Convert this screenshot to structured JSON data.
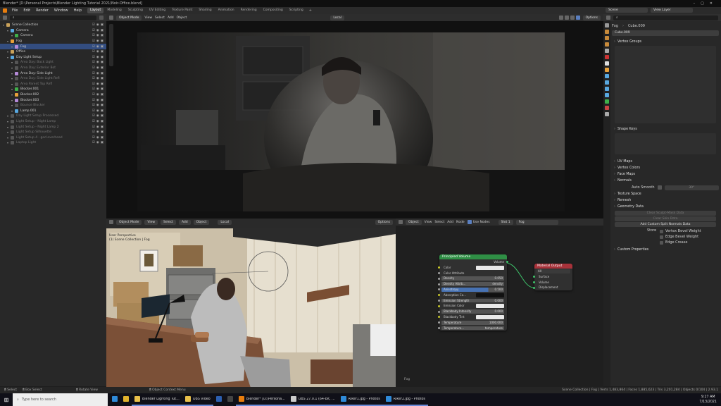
{
  "window": {
    "title": "Blender* [D:\\Personal Projects\\Blender Lighting Tutorial 2021\\Noir-Office.blend]"
  },
  "menus": [
    "File",
    "Edit",
    "Render",
    "Window",
    "Help"
  ],
  "workspace_tabs": [
    "Layout",
    "Modeling",
    "Sculpting",
    "UV Editing",
    "Texture Paint",
    "Shading",
    "Animation",
    "Rendering",
    "Compositing",
    "Scripting"
  ],
  "header_right": {
    "scene": "Scene",
    "view_layer": "View Layer"
  },
  "outliner": {
    "search_placeholder": "",
    "rows": [
      {
        "name": "Scene Collection",
        "indent": 0,
        "dim": false,
        "selected": false
      },
      {
        "name": "Camera",
        "indent": 1,
        "dim": false,
        "selected": false
      },
      {
        "name": "Camera",
        "indent": 2,
        "dim": false,
        "selected": false
      },
      {
        "name": "Fog",
        "indent": 1,
        "dim": false,
        "selected": false
      },
      {
        "name": "Fog",
        "indent": 2,
        "dim": false,
        "selected": true
      },
      {
        "name": "Office",
        "indent": 1,
        "dim": false,
        "selected": false
      },
      {
        "name": "Day Light Setup",
        "indent": 1,
        "dim": false,
        "selected": false
      },
      {
        "name": "Area Day: Back Light",
        "indent": 2,
        "dim": true,
        "selected": false
      },
      {
        "name": "Area Day: Exterior Bot",
        "indent": 2,
        "dim": true,
        "selected": false
      },
      {
        "name": "Area Day: Side Light",
        "indent": 2,
        "dim": false,
        "selected": false
      },
      {
        "name": "Area Day: Side Light Refl",
        "indent": 2,
        "dim": true,
        "selected": false
      },
      {
        "name": "Area Parent Top Refl",
        "indent": 2,
        "dim": true,
        "selected": false
      },
      {
        "name": "Blocker.001",
        "indent": 2,
        "dim": false,
        "selected": false
      },
      {
        "name": "Blocker.002",
        "indent": 2,
        "dim": false,
        "selected": false
      },
      {
        "name": "Blocker.003",
        "indent": 2,
        "dim": false,
        "selected": false
      },
      {
        "name": "Bounce Blocker",
        "indent": 2,
        "dim": true,
        "selected": false
      },
      {
        "name": "Lamp.001",
        "indent": 2,
        "dim": false,
        "selected": false
      },
      {
        "name": "Day Light Setup Processed",
        "indent": 1,
        "dim": true,
        "selected": false
      },
      {
        "name": "Light Setup - Night Lamp",
        "indent": 1,
        "dim": true,
        "selected": false
      },
      {
        "name": "Light Setup - Night Lamp 2",
        "indent": 1,
        "dim": true,
        "selected": false
      },
      {
        "name": "Light Setup Silhouette",
        "indent": 1,
        "dim": true,
        "selected": false
      },
      {
        "name": "Light Setup 4 - god overhead",
        "indent": 1,
        "dim": true,
        "selected": false
      },
      {
        "name": "Laptop Light",
        "indent": 1,
        "dim": true,
        "selected": false
      }
    ]
  },
  "render_view": {
    "mode": "Object Mode",
    "menus": [
      "View",
      "Select",
      "Add",
      "Object"
    ],
    "transform": "Local",
    "options": "Options"
  },
  "viewport": {
    "mode": "Object Mode",
    "menus": [
      "View",
      "Select",
      "Add",
      "Object"
    ],
    "transform": "Local",
    "options": "Options",
    "overlay_line1": "User Perspective",
    "overlay_line2": "(1) Scene Collection | Fog"
  },
  "node_editor": {
    "mode": "Object",
    "menus": [
      "View",
      "Select",
      "Add",
      "Node"
    ],
    "use_nodes": "Use Nodes",
    "slot": "Slot 1",
    "material": "Fog",
    "footer": "Fog",
    "principled": {
      "title": "Principled Volume",
      "output": "Volume",
      "rows": [
        {
          "label": "Color",
          "value": "",
          "kind": "color-light"
        },
        {
          "label": "Color Attribute",
          "value": "",
          "kind": "none"
        },
        {
          "label": "Density",
          "value": "0.050",
          "kind": "field"
        },
        {
          "label": "Density Attrib...",
          "value": "density",
          "kind": "field"
        },
        {
          "label": "Anisotropy",
          "value": "0.500",
          "kind": "slider",
          "fill": 0.75
        },
        {
          "label": "Absorption Co...",
          "value": "",
          "kind": "color-dark"
        },
        {
          "label": "Emission Strength",
          "value": "0.000",
          "kind": "field"
        },
        {
          "label": "Emission Color",
          "value": "",
          "kind": "color-light"
        },
        {
          "label": "Blackbody Intensity",
          "value": "0.000",
          "kind": "field"
        },
        {
          "label": "Blackbody Tint",
          "value": "",
          "kind": "color-light"
        },
        {
          "label": "Temperature",
          "value": "1000.000",
          "kind": "field"
        },
        {
          "label": "Temperature...",
          "value": "temperature",
          "kind": "field"
        }
      ]
    },
    "output_node": {
      "title": "Material Output",
      "target": "All",
      "inputs": [
        "Surface",
        "Volume",
        "Displacement"
      ]
    }
  },
  "properties": {
    "object": "Fog",
    "data": "Cube.009",
    "mesh": "Cube.009",
    "sections": [
      "Vertex Groups",
      "Shape Keys",
      "UV Maps",
      "Vertex Colors",
      "Face Maps",
      "Normals"
    ],
    "auto_smooth": "Auto Smooth",
    "auto_smooth_value": "30°",
    "sections2": [
      "Texture Space",
      "Remesh",
      "Geometry Data"
    ],
    "geo_buttons": [
      "Clear Sculpt-Mask Data",
      "Clear Skin Data",
      "Add Custom Split Normals Data"
    ],
    "store_label": "Store",
    "store_opts": [
      "Vertex Bevel Weight",
      "Edge Bevel Weight",
      "Edge Crease"
    ],
    "custom_props": "Custom Properties"
  },
  "statusbar": {
    "select": "Select",
    "box_select": "Box Select",
    "rotate_view": "Rotate View",
    "context_menu": "Object Context Menu",
    "stats": "Scene Collection | Fog | Verts 1,483,864 | Faces 1,885,623 | Tris 3,201,284 | Objects 0/104 | 2.93.1"
  },
  "taskbar": {
    "search_placeholder": "Type here to search",
    "apps": [
      {
        "label": "",
        "name": "edge",
        "color": "#2f8ad8"
      },
      {
        "label": "",
        "name": "chrome",
        "color": "#e0b22c"
      },
      {
        "label": "Blender Lighting Tut...",
        "name": "explorer",
        "color": "#e8c04a"
      },
      {
        "label": "OBS Video",
        "name": "explorer2",
        "color": "#e8c04a"
      },
      {
        "label": "",
        "name": "photoshop",
        "color": "#2c5fb0"
      },
      {
        "label": "",
        "name": "unknown",
        "color": "#444"
      },
      {
        "label": "Blender* [D:\\Persona...",
        "name": "blender",
        "color": "#e87d0d"
      },
      {
        "label": "OBS 27.0.1 (64-bit, ...",
        "name": "obs",
        "color": "#ccc"
      },
      {
        "label": "Riker1.jpg - Photos",
        "name": "photos1",
        "color": "#2f8ad8"
      },
      {
        "label": "Riker2.jpg - Photos",
        "name": "photos2",
        "color": "#2f8ad8"
      }
    ],
    "time": "9:27 AM",
    "date": "7/13/2021"
  }
}
